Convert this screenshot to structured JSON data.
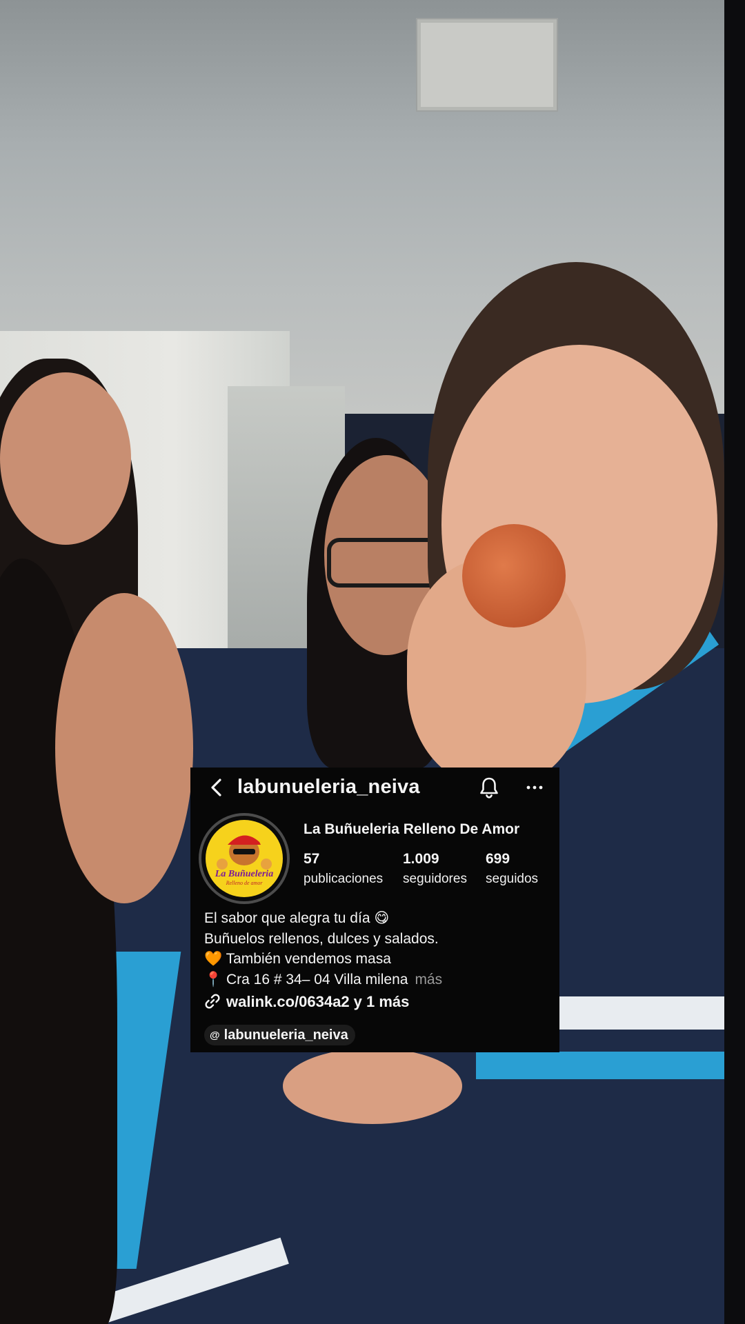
{
  "profile": {
    "handle": "labunueleria_neiva",
    "display_name": "La Buñueleria Relleno De Amor",
    "avatar_logo_text": "La Buñueleria",
    "avatar_logo_subtext": "Relleno de amor",
    "stats": [
      {
        "value": "57",
        "label": "publicaciones"
      },
      {
        "value": "1.009",
        "label": "seguidores"
      },
      {
        "value": "699",
        "label": "seguidos"
      }
    ],
    "bio_lines": [
      "El sabor que alegra tu día 😋",
      "Buñuelos rellenos, dulces y salados.",
      "🧡 También vendemos masa",
      "📍 Cra 16 # 34– 04 Villa milena"
    ],
    "bio_more": "más",
    "link": "walink.co/0634a2 y 1 más",
    "threads_handle": "labunueleria_neiva"
  },
  "icons": {
    "back": "chevron-left-icon",
    "bell": "bell-icon",
    "more": "more-horizontal-icon",
    "link": "link-icon",
    "threads": "threads-icon"
  },
  "colors": {
    "card_background": "#070707",
    "text": "#f5f5f5",
    "muted": "#9a9a9a",
    "avatar_yellow": "#f6d21c"
  }
}
